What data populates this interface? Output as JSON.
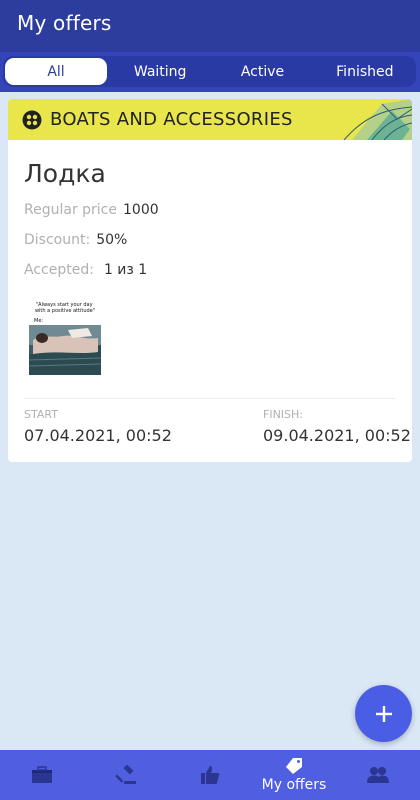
{
  "header": {
    "title": "My offers"
  },
  "tabs": [
    {
      "label": "All",
      "active": true
    },
    {
      "label": "Waiting",
      "active": false
    },
    {
      "label": "Active",
      "active": false
    },
    {
      "label": "Finished",
      "active": false
    }
  ],
  "offer": {
    "category": "BOATS AND ACCESSORIES",
    "category_icon": "grid-icon",
    "title": "Лодка",
    "regular_price_label": "Regular price",
    "regular_price_value": "1000",
    "discount_label": "Discount:",
    "discount_value": "50%",
    "accepted_label": "Accepted:",
    "accepted_value": "1 из 1",
    "image_caption": "\"Always start your day with a positive attitude\"",
    "image_subcaption": "Me:",
    "start_label": "START",
    "start_value": "07.04.2021, 00:52",
    "finish_label": "FINISH:",
    "finish_value": "09.04.2021, 00:52"
  },
  "fab": {
    "icon": "plus-icon"
  },
  "bottom_nav": [
    {
      "icon": "briefcase-icon",
      "label": ""
    },
    {
      "icon": "gavel-icon",
      "label": ""
    },
    {
      "icon": "thumbs-up-icon",
      "label": ""
    },
    {
      "icon": "tag-icon",
      "label": "My offers",
      "active": true
    },
    {
      "icon": "users-icon",
      "label": ""
    }
  ],
  "colors": {
    "appbar": "#2c3d9e",
    "tabs_bg": "#3345b8",
    "banner": "#e8e64a",
    "background": "#dae7f5",
    "nav": "#4f5fe0",
    "fab": "#4a5ee5"
  }
}
